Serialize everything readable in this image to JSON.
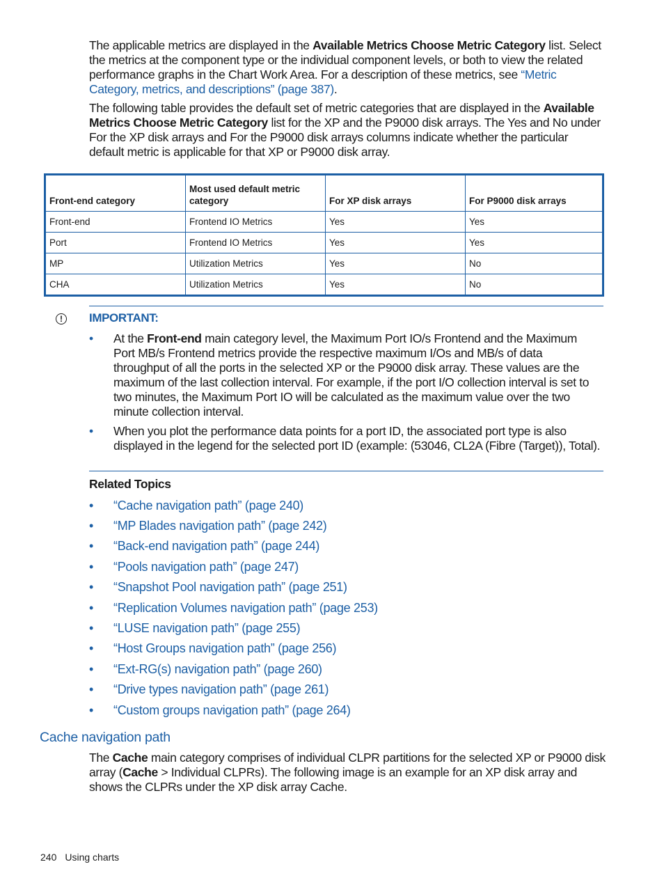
{
  "intro": {
    "p1_a": "The applicable metrics are displayed in the ",
    "p1_b": "Available Metrics Choose Metric Category",
    "p1_c": " list. Select the metrics at the component type or the individual component levels, or both to view the related performance graphs in the Chart Work Area. For a description of these metrics, see ",
    "p1_link": "“Metric Category, metrics, and descriptions” (page 387)",
    "p1_d": ".",
    "p2_a": "The following table provides the default set of metric categories that are displayed in the ",
    "p2_b": "Available Metrics Choose Metric Category",
    "p2_c": " list for the XP and the P9000 disk arrays. The Yes and No under For the XP disk arrays and For the P9000 disk arrays columns indicate whether the particular default metric is applicable for that XP or P9000 disk array."
  },
  "table": {
    "headers": [
      "Front-end category",
      "Most used default metric category",
      "For XP disk arrays",
      "For P9000 disk arrays"
    ],
    "rows": [
      [
        "Front-end",
        "Frontend IO Metrics",
        "Yes",
        "Yes"
      ],
      [
        "Port",
        "Frontend IO Metrics",
        "Yes",
        "Yes"
      ],
      [
        "MP",
        "Utilization Metrics",
        "Yes",
        "No"
      ],
      [
        "CHA",
        "Utilization Metrics",
        "Yes",
        "No"
      ]
    ]
  },
  "important": {
    "icon": "!",
    "label": "IMPORTANT:",
    "bullet1_a": "At the ",
    "bullet1_b": "Front-end",
    "bullet1_c": " main category level, the Maximum Port IO/s  Frontend and the Maximum Port MB/s  Frontend metrics provide the respective maximum I/Os and MB/s of data throughput of all the ports in the selected XP or the P9000 disk array. These values are the maximum of the last collection interval. For example, if the port I/O collection interval is set to two minutes, the Maximum Port IO will be calculated as the maximum value over the two minute collection interval.",
    "bullet2": "When you plot the performance data points for a port ID, the associated port type is also displayed in the legend for the selected port ID (example: (53046, CL2A (Fibre (Target)), Total)."
  },
  "related": {
    "title": "Related Topics",
    "items": [
      "“Cache navigation path” (page 240)",
      "“MP Blades navigation path” (page 242)",
      "“Back-end navigation path” (page 244)",
      "“Pools navigation path” (page 247)",
      "“Snapshot Pool navigation path” (page 251)",
      "“Replication Volumes navigation path” (page 253)",
      "“LUSE navigation path” (page 255)",
      "“Host Groups navigation path” (page 256)",
      "“Ext-RG(s) navigation path” (page 260)",
      "“Drive types navigation path” (page 261)",
      "“Custom groups navigation path” (page 264)"
    ]
  },
  "section": {
    "heading": "Cache navigation path",
    "p_a": "The ",
    "p_b": "Cache",
    "p_c": " main category comprises of individual CLPR partitions for the selected XP or P9000 disk array (",
    "p_d": "Cache",
    "p_e": " > Individual CLPRs). The following image is an example for an XP disk array and shows the CLPRs under the XP disk array Cache."
  },
  "footer": {
    "page": "240",
    "title": "Using charts"
  },
  "colors": {
    "accent": "#1c5fa5",
    "text": "#1a1a1a"
  }
}
